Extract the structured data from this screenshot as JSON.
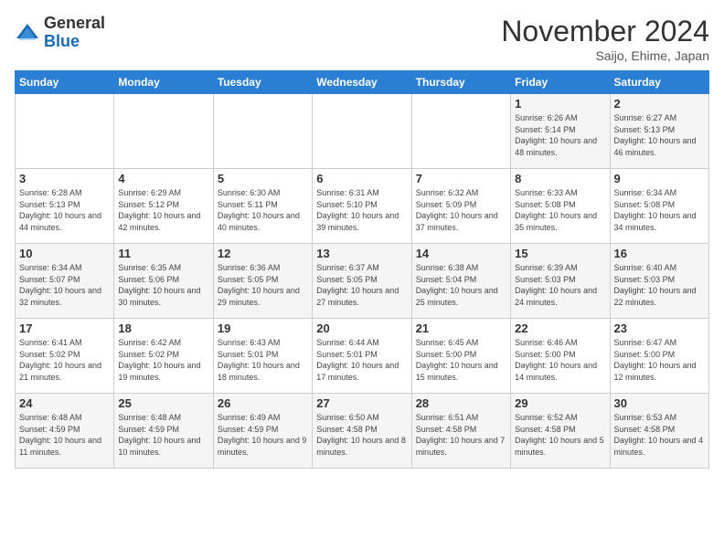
{
  "logo": {
    "general": "General",
    "blue": "Blue"
  },
  "header": {
    "title": "November 2024",
    "subtitle": "Saijo, Ehime, Japan"
  },
  "days_of_week": [
    "Sunday",
    "Monday",
    "Tuesday",
    "Wednesday",
    "Thursday",
    "Friday",
    "Saturday"
  ],
  "weeks": [
    [
      {
        "day": "",
        "info": ""
      },
      {
        "day": "",
        "info": ""
      },
      {
        "day": "",
        "info": ""
      },
      {
        "day": "",
        "info": ""
      },
      {
        "day": "",
        "info": ""
      },
      {
        "day": "1",
        "info": "Sunrise: 6:26 AM\nSunset: 5:14 PM\nDaylight: 10 hours and 48 minutes."
      },
      {
        "day": "2",
        "info": "Sunrise: 6:27 AM\nSunset: 5:13 PM\nDaylight: 10 hours and 46 minutes."
      }
    ],
    [
      {
        "day": "3",
        "info": "Sunrise: 6:28 AM\nSunset: 5:13 PM\nDaylight: 10 hours and 44 minutes."
      },
      {
        "day": "4",
        "info": "Sunrise: 6:29 AM\nSunset: 5:12 PM\nDaylight: 10 hours and 42 minutes."
      },
      {
        "day": "5",
        "info": "Sunrise: 6:30 AM\nSunset: 5:11 PM\nDaylight: 10 hours and 40 minutes."
      },
      {
        "day": "6",
        "info": "Sunrise: 6:31 AM\nSunset: 5:10 PM\nDaylight: 10 hours and 39 minutes."
      },
      {
        "day": "7",
        "info": "Sunrise: 6:32 AM\nSunset: 5:09 PM\nDaylight: 10 hours and 37 minutes."
      },
      {
        "day": "8",
        "info": "Sunrise: 6:33 AM\nSunset: 5:08 PM\nDaylight: 10 hours and 35 minutes."
      },
      {
        "day": "9",
        "info": "Sunrise: 6:34 AM\nSunset: 5:08 PM\nDaylight: 10 hours and 34 minutes."
      }
    ],
    [
      {
        "day": "10",
        "info": "Sunrise: 6:34 AM\nSunset: 5:07 PM\nDaylight: 10 hours and 32 minutes."
      },
      {
        "day": "11",
        "info": "Sunrise: 6:35 AM\nSunset: 5:06 PM\nDaylight: 10 hours and 30 minutes."
      },
      {
        "day": "12",
        "info": "Sunrise: 6:36 AM\nSunset: 5:05 PM\nDaylight: 10 hours and 29 minutes."
      },
      {
        "day": "13",
        "info": "Sunrise: 6:37 AM\nSunset: 5:05 PM\nDaylight: 10 hours and 27 minutes."
      },
      {
        "day": "14",
        "info": "Sunrise: 6:38 AM\nSunset: 5:04 PM\nDaylight: 10 hours and 25 minutes."
      },
      {
        "day": "15",
        "info": "Sunrise: 6:39 AM\nSunset: 5:03 PM\nDaylight: 10 hours and 24 minutes."
      },
      {
        "day": "16",
        "info": "Sunrise: 6:40 AM\nSunset: 5:03 PM\nDaylight: 10 hours and 22 minutes."
      }
    ],
    [
      {
        "day": "17",
        "info": "Sunrise: 6:41 AM\nSunset: 5:02 PM\nDaylight: 10 hours and 21 minutes."
      },
      {
        "day": "18",
        "info": "Sunrise: 6:42 AM\nSunset: 5:02 PM\nDaylight: 10 hours and 19 minutes."
      },
      {
        "day": "19",
        "info": "Sunrise: 6:43 AM\nSunset: 5:01 PM\nDaylight: 10 hours and 18 minutes."
      },
      {
        "day": "20",
        "info": "Sunrise: 6:44 AM\nSunset: 5:01 PM\nDaylight: 10 hours and 17 minutes."
      },
      {
        "day": "21",
        "info": "Sunrise: 6:45 AM\nSunset: 5:00 PM\nDaylight: 10 hours and 15 minutes."
      },
      {
        "day": "22",
        "info": "Sunrise: 6:46 AM\nSunset: 5:00 PM\nDaylight: 10 hours and 14 minutes."
      },
      {
        "day": "23",
        "info": "Sunrise: 6:47 AM\nSunset: 5:00 PM\nDaylight: 10 hours and 12 minutes."
      }
    ],
    [
      {
        "day": "24",
        "info": "Sunrise: 6:48 AM\nSunset: 4:59 PM\nDaylight: 10 hours and 11 minutes."
      },
      {
        "day": "25",
        "info": "Sunrise: 6:48 AM\nSunset: 4:59 PM\nDaylight: 10 hours and 10 minutes."
      },
      {
        "day": "26",
        "info": "Sunrise: 6:49 AM\nSunset: 4:59 PM\nDaylight: 10 hours and 9 minutes."
      },
      {
        "day": "27",
        "info": "Sunrise: 6:50 AM\nSunset: 4:58 PM\nDaylight: 10 hours and 8 minutes."
      },
      {
        "day": "28",
        "info": "Sunrise: 6:51 AM\nSunset: 4:58 PM\nDaylight: 10 hours and 7 minutes."
      },
      {
        "day": "29",
        "info": "Sunrise: 6:52 AM\nSunset: 4:58 PM\nDaylight: 10 hours and 5 minutes."
      },
      {
        "day": "30",
        "info": "Sunrise: 6:53 AM\nSunset: 4:58 PM\nDaylight: 10 hours and 4 minutes."
      }
    ]
  ]
}
